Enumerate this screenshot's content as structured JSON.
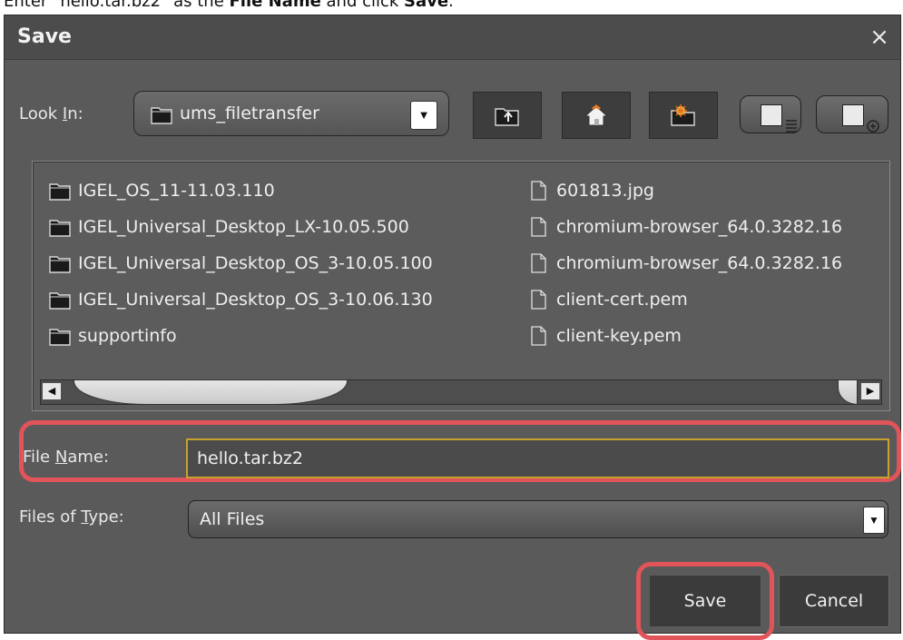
{
  "instruction": {
    "prefix": "Enter \"hello.tar.bz2\" as the ",
    "bold1": "File Name",
    "middle": " and click ",
    "bold2": "Save",
    "suffix": "."
  },
  "dialog": {
    "title": "Save",
    "close_glyph": "×",
    "look_in": {
      "label_pre": "Look ",
      "label_mnemonic": "I",
      "label_post": "n:",
      "value": "ums_filetransfer",
      "icon": "folder-icon"
    },
    "toolbar": [
      {
        "name": "up-one-level-button",
        "icon": "folder-up-icon"
      },
      {
        "name": "home-button",
        "icon": "home-icon"
      },
      {
        "name": "new-folder-button",
        "icon": "new-folder-icon"
      },
      {
        "name": "list-view-button",
        "icon": "list-view-icon"
      },
      {
        "name": "details-view-button",
        "icon": "details-view-icon"
      }
    ],
    "folders": [
      "IGEL_OS_11-11.03.110",
      "IGEL_Universal_Desktop_LX-10.05.500",
      "IGEL_Universal_Desktop_OS_3-10.05.100",
      "IGEL_Universal_Desktop_OS_3-10.06.130",
      "supportinfo"
    ],
    "files": [
      "601813.jpg",
      "chromium-browser_64.0.3282.16",
      "chromium-browser_64.0.3282.16",
      "client-cert.pem",
      "client-key.pem"
    ],
    "file_name": {
      "label_pre": "File ",
      "label_mnemonic": "N",
      "label_post": "ame:",
      "value": "hello.tar.bz2"
    },
    "file_type": {
      "label_pre": "Files of ",
      "label_mnemonic": "T",
      "label_post": "ype:",
      "value": "All Files"
    },
    "buttons": {
      "save": "Save",
      "cancel": "Cancel"
    }
  },
  "colors": {
    "dialog_bg": "#5a5a5a",
    "highlight": "#e0545a",
    "input_focus": "#c8a22e"
  }
}
